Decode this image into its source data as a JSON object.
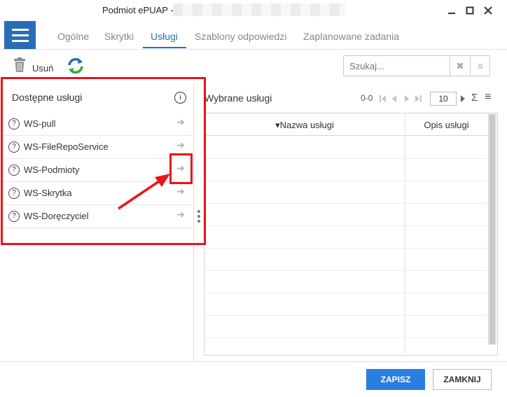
{
  "window": {
    "title": "Podmiot ePUAP -",
    "minimize_glyph": "—",
    "maximize_glyph": "□",
    "close_glyph": "✕"
  },
  "tabs": [
    {
      "label": "Ogólne"
    },
    {
      "label": "Skrytki"
    },
    {
      "label": "Usługi",
      "active": true
    },
    {
      "label": "Szablony odpowiedzi"
    },
    {
      "label": "Zaplanowane zadania"
    }
  ],
  "toolbar": {
    "delete_label": "Usuń",
    "delete_icon": "trash-icon",
    "refresh_icon": "refresh-icon"
  },
  "search": {
    "placeholder": "Szukaj...",
    "clear_glyph": "✖",
    "menu_glyph": "≡"
  },
  "available": {
    "title": "Dostępne usługi",
    "info_glyph": "i",
    "help_glyph": "?",
    "add_glyph": "➜",
    "items": [
      {
        "label": "WS-pull"
      },
      {
        "label": "WS-FileRepoService"
      },
      {
        "label": "WS-Podmioty"
      },
      {
        "label": "WS-Skrytka"
      },
      {
        "label": "WS-Doręczyciel"
      }
    ]
  },
  "selected": {
    "title": "Wybrane usługi",
    "range": "0-0",
    "page_size": "10",
    "sigma_glyph": "Σ",
    "menu_glyph": "≡",
    "columns": [
      {
        "label": "Nazwa usługi",
        "sort_glyph": "▾"
      },
      {
        "label": "Opis usługi"
      }
    ]
  },
  "footer": {
    "save_label": "ZAPISZ",
    "close_label": "ZAMKNIJ"
  },
  "colors": {
    "accent": "#2a6db5",
    "save_button": "#2a7ee0",
    "annotation": "#e8141c"
  }
}
